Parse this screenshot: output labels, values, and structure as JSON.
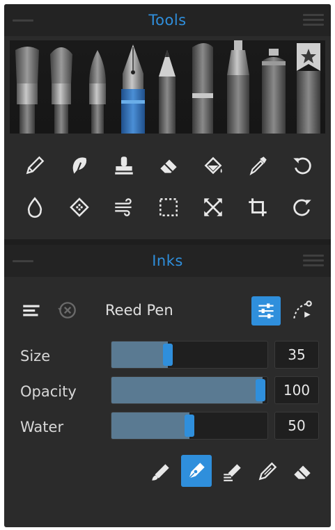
{
  "tools_panel": {
    "title": "Tools",
    "brushes": [
      {
        "name": "flat-brush"
      },
      {
        "name": "round-brush"
      },
      {
        "name": "detail-brush"
      },
      {
        "name": "ink-pen",
        "selected": true
      },
      {
        "name": "pencil"
      },
      {
        "name": "marker"
      },
      {
        "name": "felt-pen"
      },
      {
        "name": "spray-can"
      },
      {
        "name": "favorites"
      }
    ],
    "tool_icons_row1": [
      "pencil-icon",
      "smudge-icon",
      "stamp-icon",
      "eraser-icon",
      "fill-bucket-icon",
      "eyedropper-icon",
      "undo-icon"
    ],
    "tool_icons_row2": [
      "water-drop-icon",
      "texture-icon",
      "blend-icon",
      "selection-icon",
      "transform-icon",
      "crop-icon",
      "redo-icon"
    ]
  },
  "inks_panel": {
    "title": "Inks",
    "preset_name": "Reed Pen",
    "sliders": [
      {
        "label": "Size",
        "value": "35",
        "fraction": 0.35
      },
      {
        "label": "Opacity",
        "value": "100",
        "fraction": 1.0
      },
      {
        "label": "Water",
        "value": "50",
        "fraction": 0.5
      }
    ],
    "modes": [
      "ink-brush-mode-icon",
      "ink-pen-mode-icon",
      "ink-wet-mode-icon",
      "ink-outline-mode-icon",
      "ink-eraser-mode-icon"
    ],
    "selected_mode": 1
  },
  "colors": {
    "accent": "#2f8fdc",
    "panel": "#2b2b2b",
    "header": "#232323"
  }
}
